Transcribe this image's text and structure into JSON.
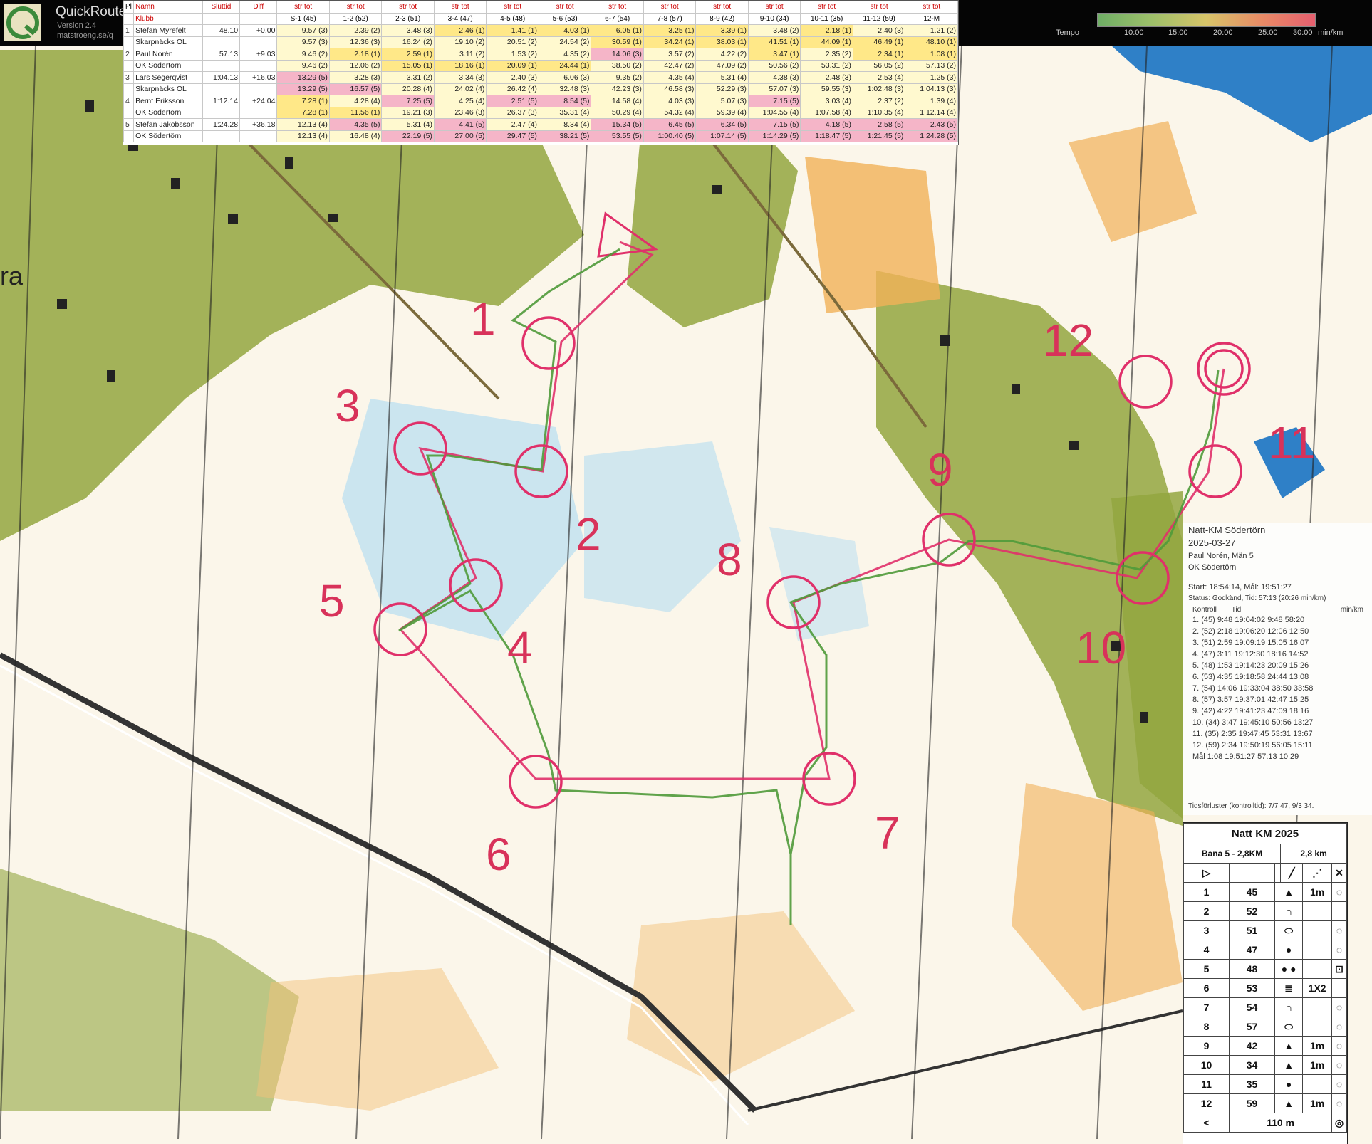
{
  "app": {
    "name": "QuickRoute",
    "version": "Version 2.4",
    "site": "matstroeng.se/q"
  },
  "tempo": {
    "label": "Tempo",
    "ticks": [
      "10:00",
      "15:00",
      "20:00",
      "25:00",
      "30:00"
    ],
    "unit": "min/km",
    "colors": [
      "#6fae66",
      "#9ec06a",
      "#d7c469",
      "#e88c66",
      "#e65f6f"
    ]
  },
  "results": {
    "headers": {
      "pl": "Pl",
      "name": "Namn",
      "club": "Klubb",
      "time": "Sluttid",
      "diff": "Diff",
      "sub": "str tot",
      "stages": [
        "S-1 (45)",
        "1-2 (52)",
        "2-3 (51)",
        "3-4 (47)",
        "4-5 (48)",
        "5-6 (53)",
        "6-7 (54)",
        "7-8 (57)",
        "8-9 (42)",
        "9-10 (34)",
        "10-11 (35)",
        "11-12 (59)",
        "12-M"
      ]
    },
    "rows": [
      {
        "pl": "1",
        "name": "Stefan Myrefelt",
        "club": "Skarpnäcks OL",
        "time": "48.10",
        "diff": "+0.00",
        "splits": [
          "9.57 (3)",
          "2.39 (2)",
          "3.48 (3)",
          "2.46 (1)",
          "1.41 (1)",
          "4.03 (1)",
          "6.05 (1)",
          "3.25 (1)",
          "3.39 (1)",
          "3.48 (2)",
          "2.18 (1)",
          "2.40 (3)",
          "1.21 (2)"
        ],
        "totals": [
          "9.57 (3)",
          "12.36 (3)",
          "16.24 (2)",
          "19.10 (2)",
          "20.51 (2)",
          "24.54 (2)",
          "30.59 (1)",
          "34.24 (1)",
          "38.03 (1)",
          "41.51 (1)",
          "44.09 (1)",
          "46.49 (1)",
          "48.10 (1)"
        ]
      },
      {
        "pl": "2",
        "name": "Paul Norén",
        "club": "OK Södertörn",
        "time": "57.13",
        "diff": "+9.03",
        "splits": [
          "9.46 (2)",
          "2.18 (1)",
          "2.59 (1)",
          "3.11 (2)",
          "1.53 (2)",
          "4.35 (2)",
          "14.06 (3)",
          "3.57 (2)",
          "4.22 (2)",
          "3.47 (1)",
          "2.35 (2)",
          "2.34 (1)",
          "1.08 (1)"
        ],
        "totals": [
          "9.46 (2)",
          "12.06 (2)",
          "15.05 (1)",
          "18.16 (1)",
          "20.09 (1)",
          "24.44 (1)",
          "38.50 (2)",
          "42.47 (2)",
          "47.09 (2)",
          "50.56 (2)",
          "53.31 (2)",
          "56.05 (2)",
          "57.13 (2)"
        ]
      },
      {
        "pl": "3",
        "name": "Lars Segerqvist",
        "club": "Skarpnäcks OL",
        "time": "1:04.13",
        "diff": "+16.03",
        "splits": [
          "13.29 (5)",
          "3.28 (3)",
          "3.31 (2)",
          "3.34 (3)",
          "2.40 (3)",
          "6.06 (3)",
          "9.35 (2)",
          "4.35 (4)",
          "5.31 (4)",
          "4.38 (3)",
          "2.48 (3)",
          "2.53 (4)",
          "1.25 (3)"
        ],
        "totals": [
          "13.29 (5)",
          "16.57 (5)",
          "20.28 (4)",
          "24.02 (4)",
          "26.42 (4)",
          "32.48 (3)",
          "42.23 (3)",
          "46.58 (3)",
          "52.29 (3)",
          "57.07 (3)",
          "59.55 (3)",
          "1:02.48 (3)",
          "1:04.13 (3)"
        ]
      },
      {
        "pl": "4",
        "name": "Bernt Eriksson",
        "club": "OK Södertörn",
        "time": "1:12.14",
        "diff": "+24.04",
        "splits": [
          "7.28 (1)",
          "4.28 (4)",
          "7.25 (5)",
          "4.25 (4)",
          "2.51 (5)",
          "8.54 (5)",
          "14.58 (4)",
          "4.03 (3)",
          "5.07 (3)",
          "7.15 (5)",
          "3.03 (4)",
          "2.37 (2)",
          "1.39 (4)"
        ],
        "totals": [
          "7.28 (1)",
          "11.56 (1)",
          "19.21 (3)",
          "23.46 (3)",
          "26.37 (3)",
          "35.31 (4)",
          "50.29 (4)",
          "54.32 (4)",
          "59.39 (4)",
          "1:04.55 (4)",
          "1:07.58 (4)",
          "1:10.35 (4)",
          "1:12.14 (4)"
        ]
      },
      {
        "pl": "5",
        "name": "Stefan Jakobsson",
        "club": "OK Södertörn",
        "time": "1:24.28",
        "diff": "+36.18",
        "splits": [
          "12.13 (4)",
          "4.35 (5)",
          "5.31 (4)",
          "4.41 (5)",
          "2.47 (4)",
          "8.34 (4)",
          "15.34 (5)",
          "6.45 (5)",
          "6.34 (5)",
          "7.15 (5)",
          "4.18 (5)",
          "2.58 (5)",
          "2.43 (5)"
        ],
        "totals": [
          "12.13 (4)",
          "16.48 (4)",
          "22.19 (5)",
          "27.00 (5)",
          "29.47 (5)",
          "38.21 (5)",
          "53.55 (5)",
          "1:00.40 (5)",
          "1:07.14 (5)",
          "1:14.29 (5)",
          "1:18.47 (5)",
          "1:21.45 (5)",
          "1:24.28 (5)"
        ]
      }
    ]
  },
  "map": {
    "controls": [
      {
        "label": "1"
      },
      {
        "label": "2"
      },
      {
        "label": "3"
      },
      {
        "label": "4"
      },
      {
        "label": "5"
      },
      {
        "label": "6"
      },
      {
        "label": "7"
      },
      {
        "label": "8"
      },
      {
        "label": "9"
      },
      {
        "label": "10"
      },
      {
        "label": "11"
      },
      {
        "label": "12"
      }
    ],
    "edge_text": "ra",
    "colors": {
      "course": "#e0306a",
      "route": "#4f9a3a",
      "forest": "#8ea23a",
      "open": "#f3b45a",
      "water": "#9fd0e8",
      "lake": "#2f80c7"
    }
  },
  "info_card": {
    "title": "Natt-KM Södertörn",
    "date": "2025-03-27",
    "runner": "Paul Norén, Män 5",
    "club": "OK Södertörn",
    "start": "Start: 18:54:14, Mål: 19:51:27",
    "status": "Status: Godkänd, Tid: 57:13 (20:26 min/km)",
    "columns": [
      "Kontroll",
      "Tid",
      "",
      "min/km"
    ],
    "rows": [
      "1. (45)   9:48  19:04:02  9:48   58:20",
      "2. (52)   2:18  19:06:20 12:06   12:50",
      "3. (51)   2:59  19:09:19 15:05   16:07",
      "4. (47)   3:11  19:12:30 18:16   14:52",
      "5. (48)   1:53  19:14:23 20:09   15:26",
      "6. (53)   4:35  19:18:58 24:44   13:08",
      "7. (54)  14:06  19:33:04 38:50   33:58",
      "8. (57)   3:57  19:37:01 42:47   15:25",
      "9. (42)   4:22  19:41:23 47:09   18:16",
      "10. (34)  3:47  19:45:10 50:56   13:27",
      "11. (35)  2:35  19:47:45 53:31   13:67",
      "12. (59)  2:34  19:50:19 56:05   15:11",
      "Mål       1:08  19:51:27 57:13   10:29"
    ],
    "footer": "Tidsförluster (kontrolltid): 7/7 47, 9/3 34."
  },
  "control_description": {
    "title": "Natt KM 2025",
    "course": "Bana 5 - 2,8KM",
    "length": "2,8 km",
    "rows": [
      {
        "no": "1",
        "code": "45",
        "feature": "▲",
        "dim": "1m",
        "loc": "◌"
      },
      {
        "no": "2",
        "code": "52",
        "feature": "∩",
        "dim": "",
        "loc": ""
      },
      {
        "no": "3",
        "code": "51",
        "feature": "⬭",
        "dim": "",
        "loc": "◌"
      },
      {
        "no": "4",
        "code": "47",
        "feature": "●",
        "dim": "",
        "loc": "◌"
      },
      {
        "no": "5",
        "code": "48",
        "feature": "● ●",
        "dim": "",
        "loc": "⊡"
      },
      {
        "no": "6",
        "code": "53",
        "feature": "≣",
        "dim": "1X2",
        "loc": ""
      },
      {
        "no": "7",
        "code": "54",
        "feature": "∩",
        "dim": "",
        "loc": "◌"
      },
      {
        "no": "8",
        "code": "57",
        "feature": "⬭",
        "dim": "",
        "loc": "◌"
      },
      {
        "no": "9",
        "code": "42",
        "feature": "▲",
        "dim": "1m",
        "loc": "◌"
      },
      {
        "no": "10",
        "code": "34",
        "feature": "▲",
        "dim": "1m",
        "loc": "◌"
      },
      {
        "no": "11",
        "code": "35",
        "feature": "●",
        "dim": "",
        "loc": "◌"
      },
      {
        "no": "12",
        "code": "59",
        "feature": "▲",
        "dim": "1m",
        "loc": "◌"
      }
    ],
    "finish": "110 m"
  }
}
